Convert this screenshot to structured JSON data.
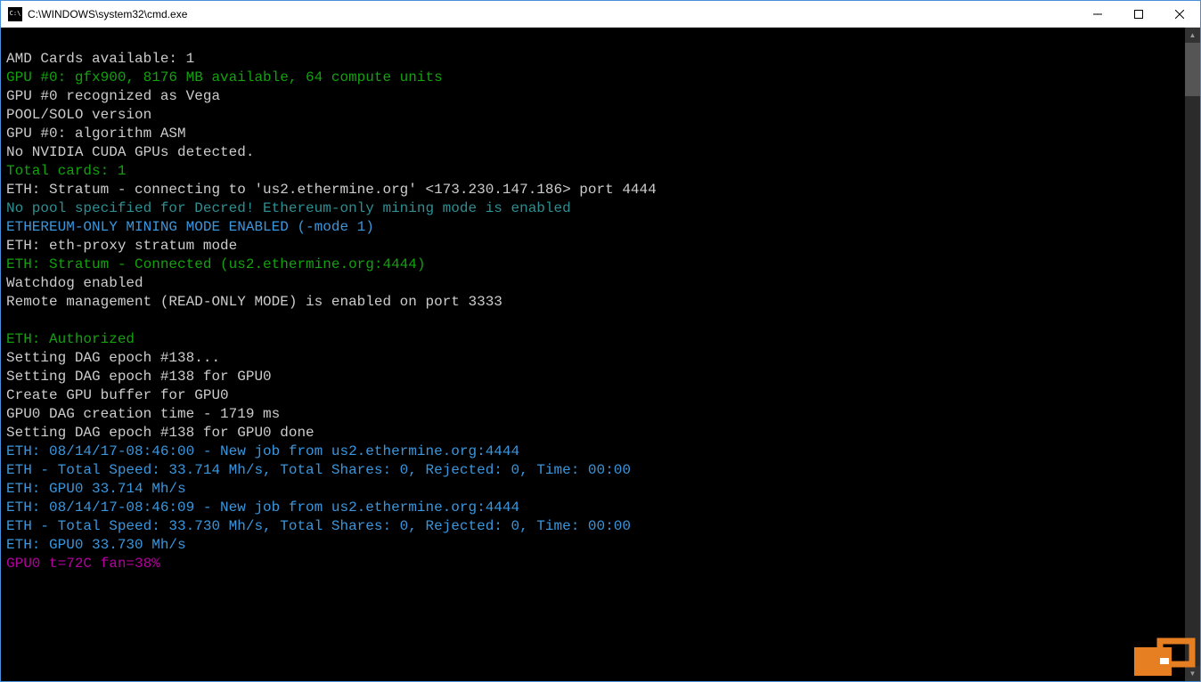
{
  "window": {
    "title": "C:\\WINDOWS\\system32\\cmd.exe"
  },
  "terminal": {
    "lines": [
      {
        "cls": "c-white",
        "text": ""
      },
      {
        "cls": "c-white",
        "text": "AMD Cards available: 1"
      },
      {
        "cls": "c-green",
        "text": "GPU #0: gfx900, 8176 MB available, 64 compute units"
      },
      {
        "cls": "c-white",
        "text": "GPU #0 recognized as Vega"
      },
      {
        "cls": "c-white",
        "text": "POOL/SOLO version"
      },
      {
        "cls": "c-white",
        "text": "GPU #0: algorithm ASM"
      },
      {
        "cls": "c-white",
        "text": "No NVIDIA CUDA GPUs detected."
      },
      {
        "cls": "c-green",
        "text": "Total cards: 1"
      },
      {
        "cls": "c-white",
        "text": "ETH: Stratum - connecting to 'us2.ethermine.org' <173.230.147.186> port 4444"
      },
      {
        "cls": "c-dcyan",
        "text": "No pool specified for Decred! Ethereum-only mining mode is enabled"
      },
      {
        "cls": "c-cyan",
        "text": "ETHEREUM-ONLY MINING MODE ENABLED (-mode 1)"
      },
      {
        "cls": "c-white",
        "text": "ETH: eth-proxy stratum mode"
      },
      {
        "cls": "c-green",
        "text": "ETH: Stratum - Connected (us2.ethermine.org:4444)"
      },
      {
        "cls": "c-white",
        "text": "Watchdog enabled"
      },
      {
        "cls": "c-white",
        "text": "Remote management (READ-ONLY MODE) is enabled on port 3333"
      },
      {
        "cls": "c-white",
        "text": ""
      },
      {
        "cls": "c-green",
        "text": "ETH: Authorized"
      },
      {
        "cls": "c-white",
        "text": "Setting DAG epoch #138..."
      },
      {
        "cls": "c-white",
        "text": "Setting DAG epoch #138 for GPU0"
      },
      {
        "cls": "c-white",
        "text": "Create GPU buffer for GPU0"
      },
      {
        "cls": "c-white",
        "text": "GPU0 DAG creation time - 1719 ms"
      },
      {
        "cls": "c-white",
        "text": "Setting DAG epoch #138 for GPU0 done"
      },
      {
        "cls": "c-cyan",
        "text": "ETH: 08/14/17-08:46:00 - New job from us2.ethermine.org:4444"
      },
      {
        "cls": "c-cyan",
        "text": "ETH - Total Speed: 33.714 Mh/s, Total Shares: 0, Rejected: 0, Time: 00:00"
      },
      {
        "cls": "c-cyan",
        "text": "ETH: GPU0 33.714 Mh/s"
      },
      {
        "cls": "c-cyan",
        "text": "ETH: 08/14/17-08:46:09 - New job from us2.ethermine.org:4444"
      },
      {
        "cls": "c-cyan",
        "text": "ETH - Total Speed: 33.730 Mh/s, Total Shares: 0, Rejected: 0, Time: 00:00"
      },
      {
        "cls": "c-cyan",
        "text": "ETH: GPU0 33.730 Mh/s"
      },
      {
        "cls": "c-magenta",
        "text": "GPU0 t=72C fan=38%"
      }
    ]
  }
}
